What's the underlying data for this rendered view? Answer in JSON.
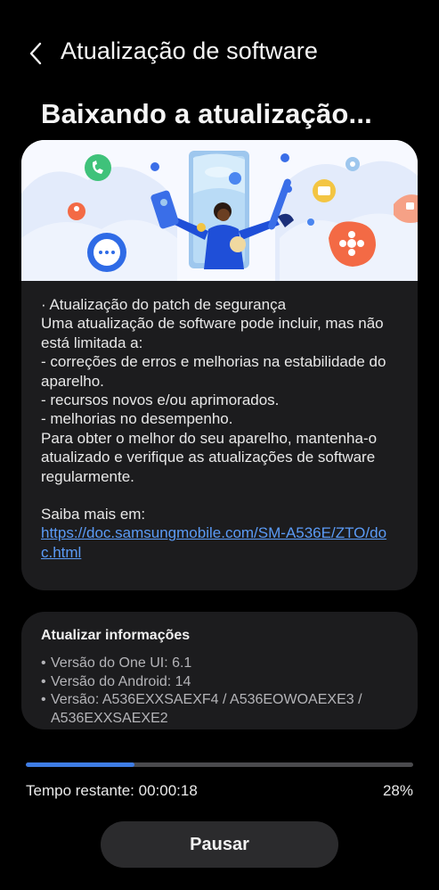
{
  "header": {
    "title": "Atualização de software",
    "back_icon": "chevron-left-icon"
  },
  "status": {
    "title": "Baixando a atualização..."
  },
  "release_notes": {
    "lines": [
      "· Atualização do patch de segurança",
      "Uma atualização de software pode incluir, mas não está limitada a:",
      " - correções de erros e melhorias na estabilidade do aparelho.",
      " - recursos novos e/ou aprimorados.",
      " - melhorias no desempenho.",
      "Para obter o melhor do seu aparelho, mantenha-o atualizado e verifique as atualizações de software regularmente."
    ],
    "learn_more_label": "Saiba mais em:",
    "link": "https://doc.samsungmobile.com/SM-A536E/ZTO/doc.html"
  },
  "info": {
    "title": "Atualizar informações",
    "items": [
      "Versão do One UI: 6.1",
      "Versão do Android: 14",
      "Versão: A536EXXSAEXF4 / A536EOWOAEXE3 / A536EXXSAEXE2"
    ]
  },
  "progress": {
    "percent_value": 28,
    "time_remaining": "Tempo restante: 00:00:18",
    "percent_label": "28%"
  },
  "actions": {
    "pause_label": "Pausar"
  },
  "colors": {
    "accent": "#3e7ce5",
    "link": "#5b9bf6",
    "card": "#1c1c1e",
    "background": "#000000"
  }
}
